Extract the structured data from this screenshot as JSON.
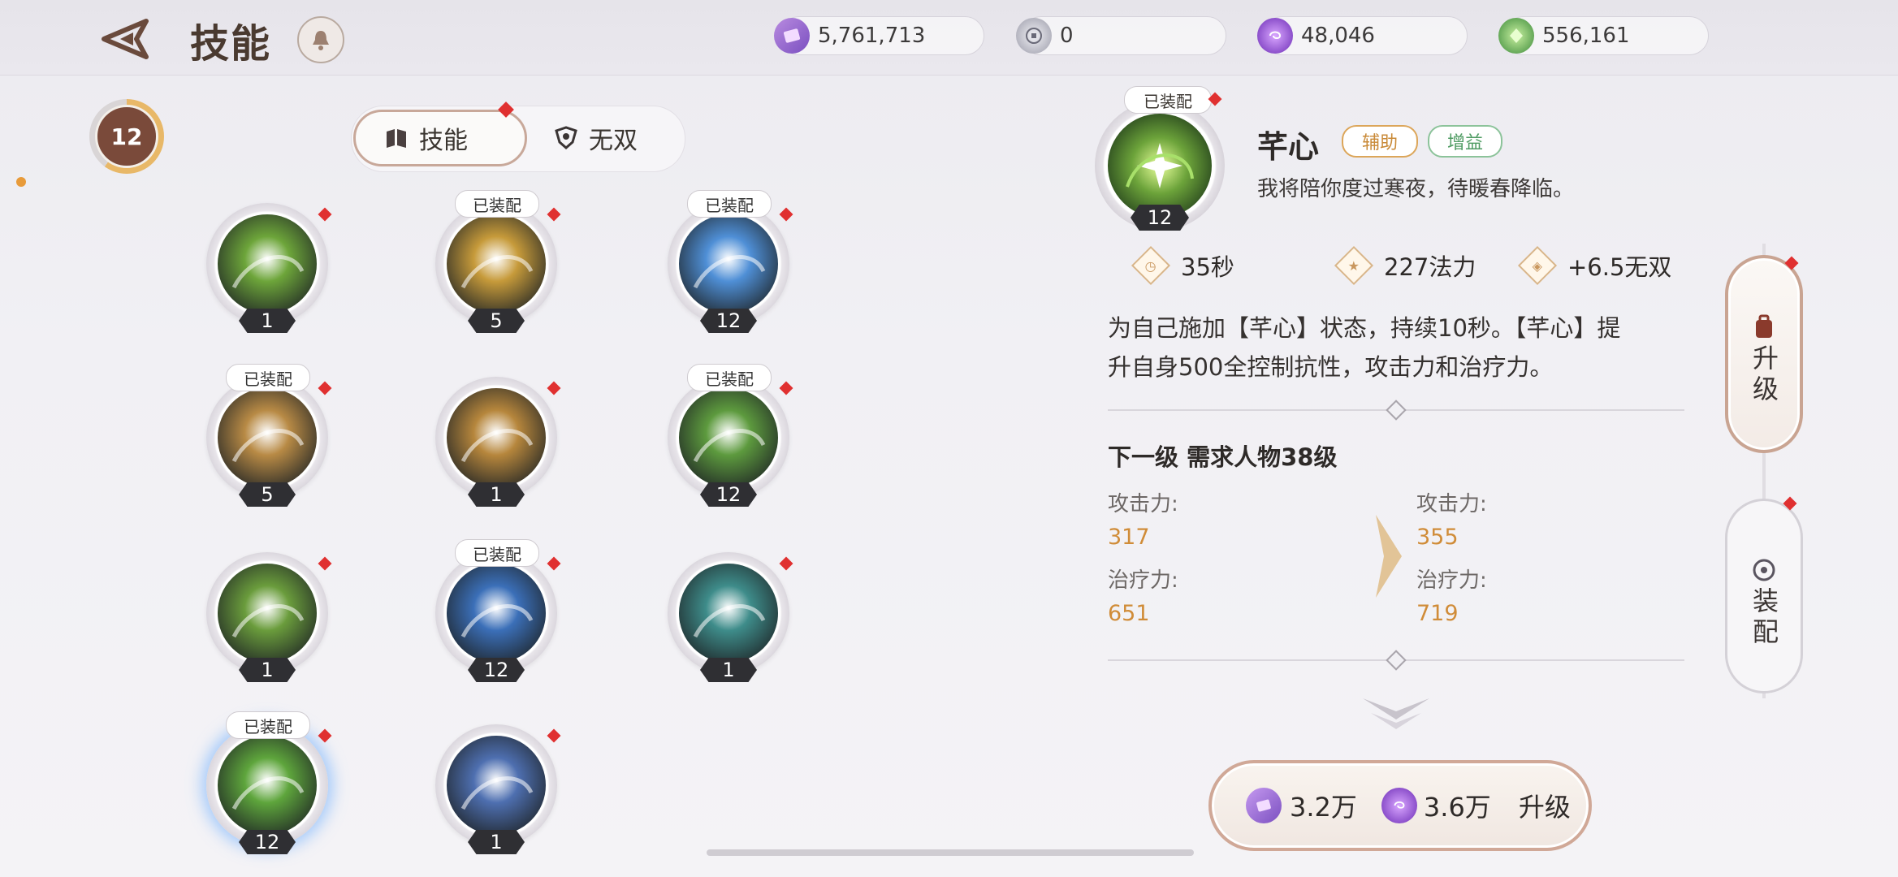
{
  "header": {
    "title": "技能",
    "currencies": [
      {
        "icon": "purple-ticket-icon",
        "value": "5,761,713"
      },
      {
        "icon": "silver-coin-icon",
        "value": "0"
      },
      {
        "icon": "purple-orb-icon",
        "value": "48,046"
      },
      {
        "icon": "green-gem-icon",
        "value": "556,161"
      }
    ]
  },
  "level_badge": "12",
  "tabs": {
    "skills": "技能",
    "musou": "无双"
  },
  "skills": [
    {
      "level": "1",
      "equipped": "",
      "color": "#6da53a"
    },
    {
      "level": "5",
      "equipped": "已装配",
      "color": "#c69a3a"
    },
    {
      "level": "12",
      "equipped": "已装配",
      "color": "#4f8fd6"
    },
    {
      "level": "5",
      "equipped": "已装配",
      "color": "#b88a45"
    },
    {
      "level": "1",
      "equipped": "",
      "color": "#b6863c"
    },
    {
      "level": "12",
      "equipped": "已装配",
      "color": "#5d9a3e"
    },
    {
      "level": "1",
      "equipped": "",
      "color": "#6a9c3c"
    },
    {
      "level": "12",
      "equipped": "已装配",
      "color": "#3b6fb8"
    },
    {
      "level": "1",
      "equipped": "",
      "color": "#3e8c8a"
    },
    {
      "level": "12",
      "equipped": "已装配",
      "color": "#5ea53c"
    },
    {
      "level": "1",
      "equipped": "",
      "color": "#4e6fb0"
    }
  ],
  "detail": {
    "equipped": "已装配",
    "level": "12",
    "name": "芊心",
    "tag_assist": "辅助",
    "tag_buff": "增益",
    "quote": "我将陪你度过寒夜，待暖春降临。",
    "stats": {
      "cooldown": "35秒",
      "mana": "227法力",
      "musou": "+6.5无双"
    },
    "description_line1": "为自己施加【芊心】状态，持续10秒。【芊心】提",
    "description_line2": "升自身500全控制抗性，攻击力和治疗力。",
    "next_level": "下一级 需求人物38级",
    "attack_label": "攻击力:",
    "heal_label": "治疗力:",
    "attack_now": "317",
    "attack_next": "355",
    "heal_now": "651",
    "heal_next": "719"
  },
  "upgrade": {
    "cost1": "3.2万",
    "cost2": "3.6万",
    "label": "升级"
  },
  "side_tabs": {
    "upgrade": "升级",
    "equip": "装配"
  }
}
